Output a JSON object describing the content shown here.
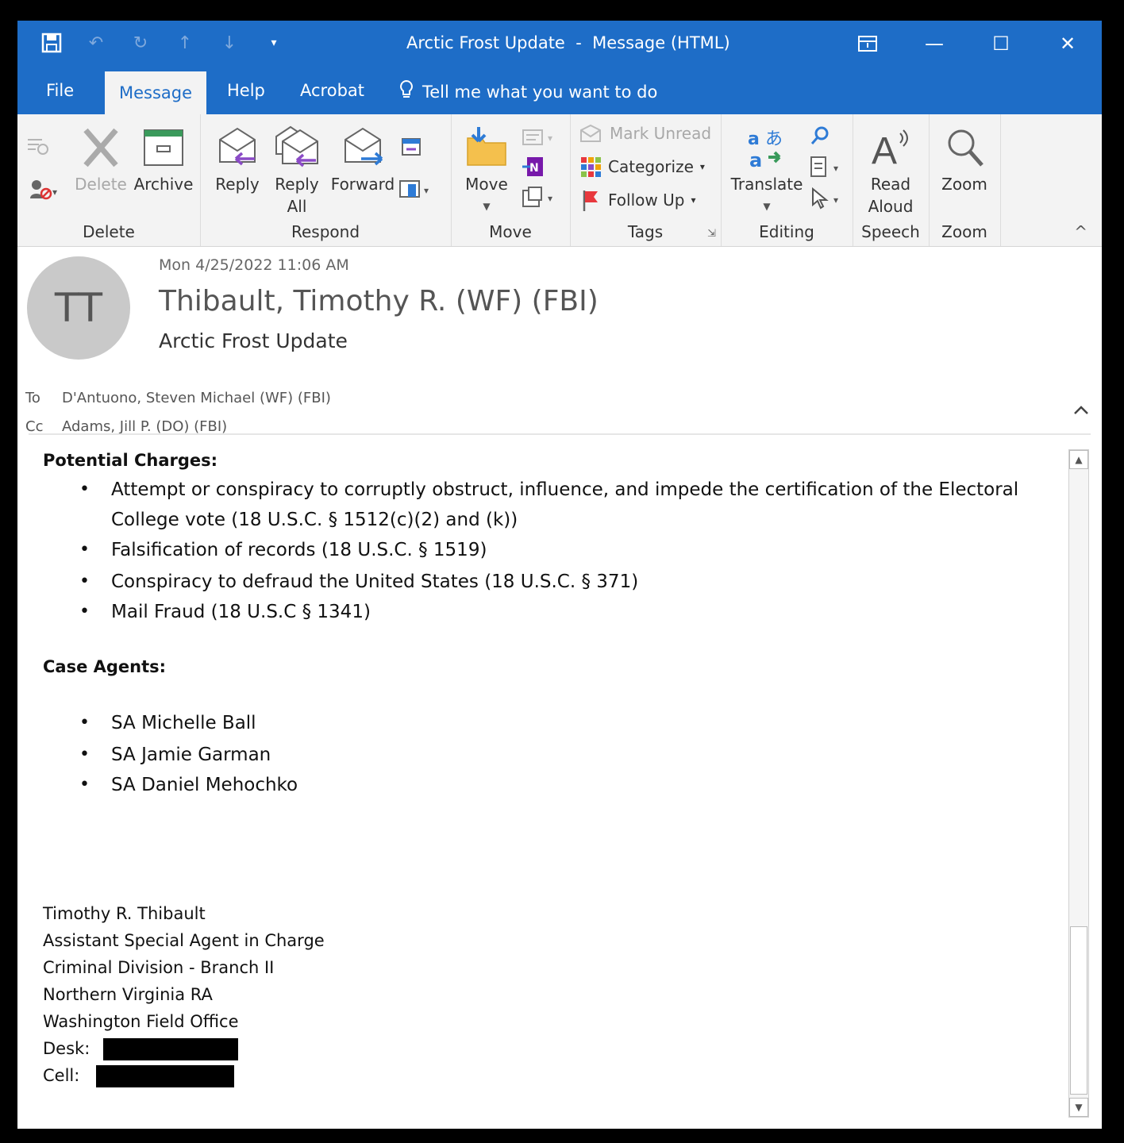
{
  "window": {
    "title": "Arctic Frost Update  -  Message (HTML)"
  },
  "tabs": [
    {
      "label": "File"
    },
    {
      "label": "Message"
    },
    {
      "label": "Help"
    },
    {
      "label": "Acrobat"
    },
    {
      "label": "Tell me what you want to do"
    }
  ],
  "ribbon": {
    "delete_group": {
      "label": "Delete",
      "delete": "Delete",
      "archive": "Archive"
    },
    "respond_group": {
      "label": "Respond",
      "reply": "Reply",
      "reply_all_1": "Reply",
      "reply_all_2": "All",
      "forward": "Forward"
    },
    "move_group": {
      "label": "Move",
      "move": "Move"
    },
    "tags_group": {
      "label": "Tags",
      "mark_unread": "Mark Unread",
      "categorize": "Categorize",
      "follow_up": "Follow Up"
    },
    "editing_group": {
      "label": "Editing",
      "translate": "Translate"
    },
    "speech_group": {
      "label": "Speech",
      "read_aloud_1": "Read",
      "read_aloud_2": "Aloud"
    },
    "zoom_group": {
      "label": "Zoom",
      "zoom": "Zoom"
    }
  },
  "message": {
    "avatar_initials": "TT",
    "date": "Mon 4/25/2022 11:06 AM",
    "sender": "Thibault, Timothy R. (WF) (FBI)",
    "subject": "Arctic Frost Update",
    "to_label": "To",
    "to": "D'Antuono, Steven Michael (WF) (FBI)",
    "cc_label": "Cc",
    "cc": "Adams, Jill P. (DO) (FBI)"
  },
  "body": {
    "charges_heading": "Potential Charges:",
    "charges": [
      "Attempt or conspiracy to corruptly obstruct, influence, and impede the certification of the Electoral College vote (18 U.S.C. § 1512(c)(2) and (k))",
      "Falsification of records (18 U.S.C. § 1519)",
      "Conspiracy to defraud the United States (18 U.S.C. § 371)",
      "Mail Fraud (18 U.S.C § 1341)"
    ],
    "agents_heading": "Case Agents:",
    "agents": [
      "SA Michelle Ball",
      "SA Jamie Garman",
      "SA Daniel Mehochko"
    ],
    "signature": {
      "name": "Timothy R. Thibault",
      "title": "Assistant Special Agent in Charge",
      "division": "Criminal Division - Branch II",
      "office": "Northern Virginia RA",
      "field_office": "Washington Field Office",
      "desk_label": "Desk:",
      "cell_label": "Cell:"
    }
  },
  "colors": {
    "accent": "#1e6dc7",
    "ribbon_bg": "#f3f3f3",
    "avatar_bg": "#c9c9c9"
  }
}
